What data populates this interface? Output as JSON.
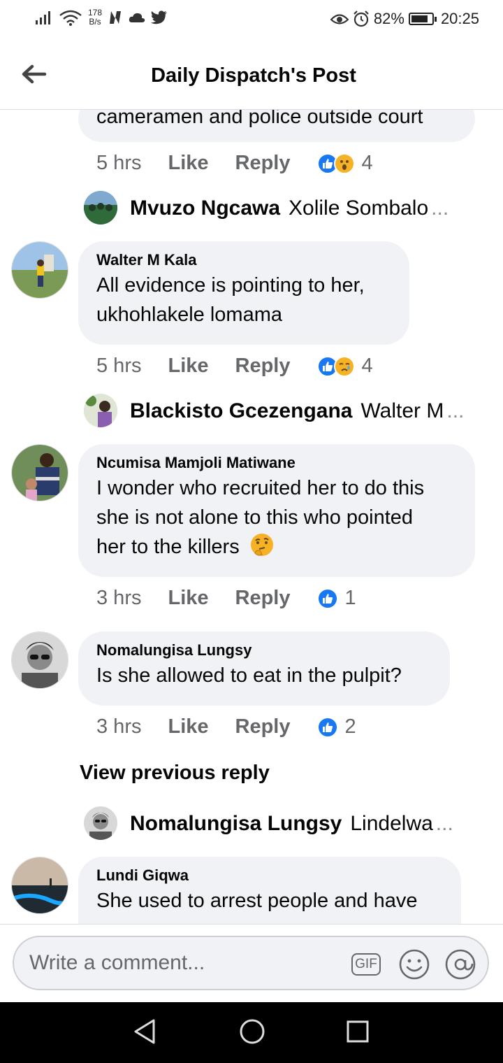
{
  "status_bar": {
    "net_speed_value": "178",
    "net_speed_unit": "B/s",
    "battery": "82%",
    "battery_level": 0.82,
    "time": "20:25"
  },
  "header": {
    "title": "Daily Dispatch's Post"
  },
  "comments": [
    {
      "text_cont": "cameramen and police outside court",
      "time": "5 hrs",
      "like": "Like",
      "reply": "Reply",
      "reactions": [
        "like-icon",
        "wow-icon"
      ],
      "count": "4",
      "reply_preview": {
        "name": "Mvuzo Ngcawa",
        "text": "Xolile Sombalo",
        "ellipsis": "..."
      }
    },
    {
      "name": "Walter M Kala",
      "lines": [
        "All evidence is pointing to her,",
        "ukhohlakele lomama"
      ],
      "time": "5 hrs",
      "like": "Like",
      "reply": "Reply",
      "reactions": [
        "like-icon",
        "sad-icon"
      ],
      "count": "4",
      "reply_preview": {
        "name": "Blackisto Gcezengana",
        "text": "Walter M",
        "ellipsis": "..."
      }
    },
    {
      "name": "Ncumisa Mamjoli Matiwane",
      "lines": [
        "I wonder who recruited her to do this",
        "she is not alone to this who pointed",
        "her to the killers"
      ],
      "emoji": "thinking-face-icon",
      "time": "3 hrs",
      "like": "Like",
      "reply": "Reply",
      "reactions": [
        "like-icon"
      ],
      "count": "1"
    },
    {
      "name": "Nomalungisa Lungsy",
      "lines": [
        "Is she allowed to eat in the pulpit?"
      ],
      "time": "3 hrs",
      "like": "Like",
      "reply": "Reply",
      "reactions": [
        "like-icon"
      ],
      "count": "2",
      "view_previous": "View previous reply",
      "reply_preview": {
        "name": "Nomalungisa Lungsy",
        "text": "Lindelwa",
        "ellipsis": "..."
      }
    },
    {
      "name": "Lundi Giqwa",
      "lines": [
        "She used to arrest people and have"
      ]
    }
  ],
  "composer": {
    "placeholder": "Write a comment...",
    "gif_label": "GIF",
    "icons": [
      "gif-icon",
      "emoji-icon",
      "mention-icon"
    ]
  },
  "nav_icons": [
    "back-triangle-icon",
    "home-circle-icon",
    "recents-square-icon"
  ]
}
